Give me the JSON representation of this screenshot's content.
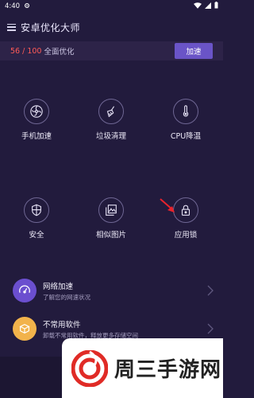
{
  "status_bar": {
    "time": "4:40",
    "notify_icon": "gear-icon"
  },
  "app": {
    "title": "安卓优化大师"
  },
  "score": {
    "value": "56 / 100",
    "label": "全面优化",
    "boost_button": "加速"
  },
  "features": [
    {
      "label": "手机加速",
      "icon": "fan-icon"
    },
    {
      "label": "垃圾清理",
      "icon": "broom-icon"
    },
    {
      "label": "CPU降温",
      "icon": "thermometer-icon"
    },
    {
      "label": "安全",
      "icon": "shield-icon"
    },
    {
      "label": "相似图片",
      "icon": "photos-icon"
    },
    {
      "label": "应用锁",
      "icon": "lock-icon"
    }
  ],
  "list": [
    {
      "title": "网络加速",
      "subtitle": "了解您的网速状况",
      "icon": "speedometer-icon",
      "color": "#6b4fcf"
    },
    {
      "title": "不常用软件",
      "subtitle": "卸载不常用软件，释放更多存储空间",
      "icon": "box-icon",
      "color": "#f2b34b"
    }
  ],
  "watermark": {
    "text": "周三手游网"
  },
  "colors": {
    "background": "#221b3d",
    "accent": "#6a54c7",
    "score_red": "#ff5a57"
  }
}
